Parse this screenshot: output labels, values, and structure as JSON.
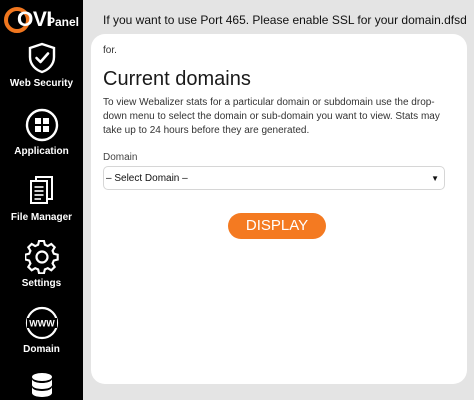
{
  "brand": {
    "logo_text": "OVI",
    "logo_sub": "Panel",
    "accent": "#f47a21"
  },
  "sidebar": {
    "items": [
      {
        "label": "Web Security",
        "icon": "shield-icon"
      },
      {
        "label": "Application",
        "icon": "grid-icon"
      },
      {
        "label": "File Manager",
        "icon": "files-icon"
      },
      {
        "label": "Settings",
        "icon": "gear-icon"
      },
      {
        "label": "Domain",
        "icon": "www-icon"
      },
      {
        "label": "",
        "icon": "database-icon"
      }
    ]
  },
  "topbar": {
    "message": "If you want to use Port 465. Please enable SSL for your domain.dfsd"
  },
  "main": {
    "cut_text": "for.",
    "title": "Current domains",
    "description": "To view Webalizer stats for a particular domain or subdomain use the drop-down menu to select the domain or sub-domain you want to view. Stats may take up to 24 hours before they are generated.",
    "domain_label": "Domain",
    "select_value": "– Select Domain –",
    "display_button": "DISPLAY"
  }
}
